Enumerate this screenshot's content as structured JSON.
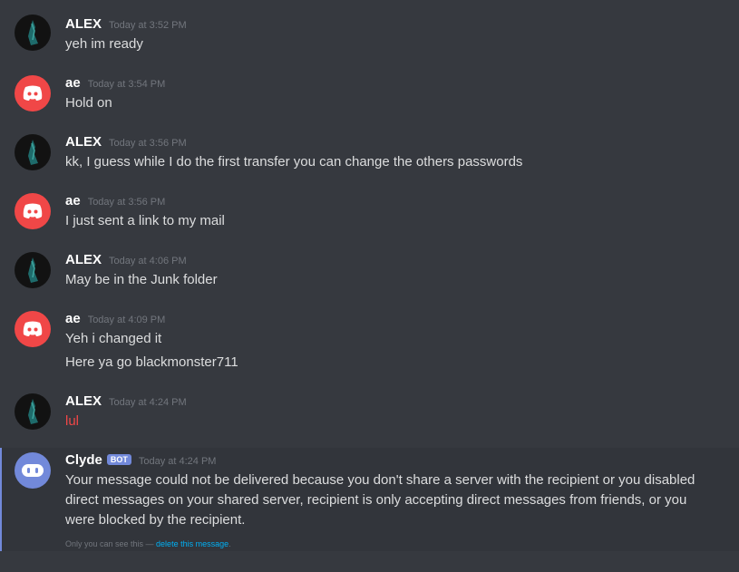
{
  "messages": [
    {
      "author": "ALEX",
      "timestamp": "Today at 3:52 PM",
      "lines": [
        "yeh im ready"
      ]
    },
    {
      "author": "ae",
      "timestamp": "Today at 3:54 PM",
      "lines": [
        "Hold on"
      ]
    },
    {
      "author": "ALEX",
      "timestamp": "Today at 3:56 PM",
      "lines": [
        "kk, I guess while I do the first transfer you can change the others passwords"
      ]
    },
    {
      "author": "ae",
      "timestamp": "Today at 3:56 PM",
      "lines": [
        "I just sent a link to my mail"
      ]
    },
    {
      "author": "ALEX",
      "timestamp": "Today at 4:06 PM",
      "lines": [
        "May be in the Junk folder"
      ]
    },
    {
      "author": "ae",
      "timestamp": "Today at 4:09 PM",
      "lines": [
        "Yeh i changed it",
        "Here ya go blackmonster711"
      ]
    },
    {
      "author": "ALEX",
      "timestamp": "Today at 4:24 PM",
      "lines": [
        "lul"
      ]
    }
  ],
  "clyde": {
    "author": "Clyde",
    "badge": "BOT",
    "timestamp": "Today at 4:24 PM",
    "text": "Your message could not be delivered because you don't share a server with the recipient or you disabled direct messages on your shared server, recipient is only accepting direct messages from friends, or you were blocked by the recipient.",
    "note_prefix": "Only you can see this — ",
    "note_link": "delete this message",
    "note_suffix": "."
  },
  "colors": {
    "accent": "#7289da",
    "ae_avatar": "#f04747",
    "link": "#00b0f4",
    "highlight_text": "#f04747"
  }
}
